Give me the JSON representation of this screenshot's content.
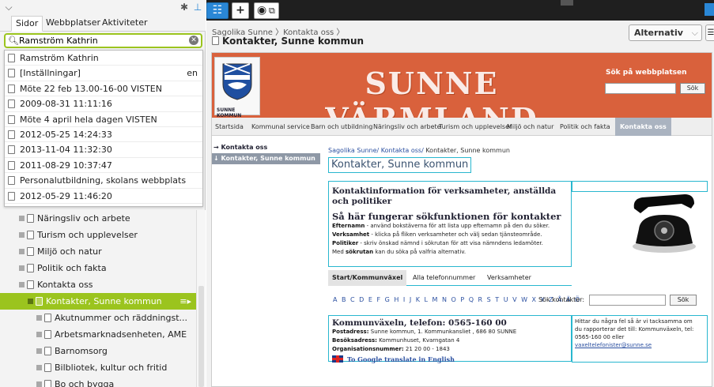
{
  "left_panel": {
    "tabs": [
      {
        "label": "Sidor"
      },
      {
        "label": "Webbplatser"
      },
      {
        "label": "Aktiviteter"
      }
    ],
    "search": {
      "value": "Ramström Kathrin"
    },
    "results": [
      {
        "label": "Ramström Kathrin",
        "lang": ""
      },
      {
        "label": "[Inställningar]",
        "lang": "en"
      },
      {
        "label": "Möte 22 feb 13.00-16-00 VISTEN",
        "lang": ""
      },
      {
        "label": "2009-08-31 11:11:16",
        "lang": ""
      },
      {
        "label": "Möte 4 april hela dagen VISTEN",
        "lang": ""
      },
      {
        "label": "2012-05-25 14:24:33",
        "lang": ""
      },
      {
        "label": "2013-11-04 11:32:30",
        "lang": ""
      },
      {
        "label": "2011-08-29 10:37:47",
        "lang": ""
      },
      {
        "label": "Personalutbildning, skolans webbplats",
        "lang": ""
      },
      {
        "label": "2012-05-29 11:46:20",
        "lang": ""
      }
    ],
    "tree": [
      {
        "label": "Näringsliv och arbete",
        "level": 1
      },
      {
        "label": "Turism och upplevelser",
        "level": 1
      },
      {
        "label": "Miljö och natur",
        "level": 1
      },
      {
        "label": "Politik och fakta",
        "level": 1
      },
      {
        "label": "Kontakta oss",
        "level": 1
      },
      {
        "label": "Kontakter, Sunne kommun",
        "level": 2,
        "selected": true
      },
      {
        "label": "Akutnummer och räddningst...",
        "level": 3
      },
      {
        "label": "Arbetsmarknadsenheten, AME",
        "level": 3
      },
      {
        "label": "Barnomsorg",
        "level": 3
      },
      {
        "label": "Bilbliotek, kultur och fritid",
        "level": 3
      },
      {
        "label": "Bo och bygga",
        "level": 3
      }
    ]
  },
  "header": {
    "breadcrumb": "Sagolika Sunne 〉Kontakta oss 〉",
    "page_title": "Kontakter, Sunne kommun",
    "alt_button": "Alternativ"
  },
  "site": {
    "logo_text": "SUNNE KOMMUN",
    "banner_title": "SUNNE  VÄRMLAND",
    "search_label": "Sök på webbplatsen",
    "search_button": "Sök",
    "nav": [
      {
        "label": "Startsida"
      },
      {
        "label": "Kommunal service"
      },
      {
        "label": "Barn och utbildning"
      },
      {
        "label": "Näringsliv och arbete"
      },
      {
        "label": "Turism och upplevelser"
      },
      {
        "label": "Miljö och natur"
      },
      {
        "label": "Politik och fakta"
      },
      {
        "label": "Kontakta oss"
      }
    ],
    "side": [
      {
        "label": "→ Kontakta oss"
      },
      {
        "label": "↓ Kontakter, Sunne kommun"
      }
    ],
    "crumb_links": "Sagolika Sunne/ Kontakta oss/",
    "crumb_current": " Kontakter, Sunne kommun",
    "heading": "Kontakter, Sunne kommun",
    "info_title": "Kontaktinformation för verksamheter, anställda och politiker",
    "how_title": "Så här fungerar sökfunktionen för kontakter",
    "how_lines": [
      {
        "bold": "Efternamn",
        "text": " - använd bokstäverna för att lista upp efternamn på den du söker."
      },
      {
        "bold": "Verksamhet",
        "text": " - klicka på fliken verksamheter och välj sedan tjänsteområde."
      },
      {
        "bold": "Politiker",
        "text": " - skriv önskad nämnd i sökrutan för att visa nämndens ledamöter."
      },
      {
        "pre": "Med ",
        "bold": "sökrutan",
        "text": " kan du söka på valfria alternativ."
      }
    ],
    "tabs": [
      {
        "label": "Start/Kommunväxel"
      },
      {
        "label": "Alla telefonnummer"
      },
      {
        "label": "Verksamheter"
      }
    ],
    "alphabet": "A B C D E F G H I J K L M N O P Q R S T U V W X Y Z Å Ä Ö",
    "alpha_label": "Sök kontakter:",
    "alpha_button": "Sök",
    "switch_title": "Kommunväxeln, telefon: 0565-160 00",
    "switch_lines": [
      {
        "bold": "Postadress:",
        "text": " Sunne kommun, 1. Kommunkansliet ,  686 80  SUNNE"
      },
      {
        "bold": "Besöksadress:",
        "text": " Kommunhuset, Kvarngatan 4"
      },
      {
        "bold": "Organisationsnummer:",
        "text": " 21 20 00 - 1843"
      }
    ],
    "translate": "To Google translate in English",
    "note_lines": [
      "Hittar du några fel så är vi tacksamma om",
      "du rapporterar det till: Kommunväxeln, tel:",
      "0565-160 00 eller"
    ],
    "note_link": "vaxeltelefonister@sunne.se"
  },
  "colors": {
    "accent_green": "#9bc41e",
    "accent_blue": "#2a87d6",
    "banner_orange": "#d9613c",
    "cyan_outline": "#29b7cf"
  }
}
